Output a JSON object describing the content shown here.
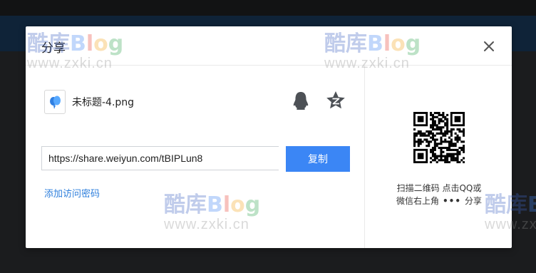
{
  "dialog": {
    "title": "分享",
    "close_icon": "close-icon"
  },
  "file": {
    "name": "未标题-4.png",
    "icon": "image-file-icon"
  },
  "share_targets": [
    {
      "name": "qq-share-button",
      "icon": "qq-penguin-icon"
    },
    {
      "name": "qzone-share-button",
      "icon": "qzone-star-icon"
    }
  ],
  "link": {
    "url": "https://share.weiyun.com/tBIPLun8",
    "copy_label": "复制"
  },
  "add_password_label": "添加访问密码",
  "qr": {
    "caption_line1": "扫描二维码 点击QQ或",
    "caption_line2_pre": "微信右上角",
    "caption_dots": "•••",
    "caption_line2_post": "分享"
  },
  "watermark": {
    "brand_prefix": "酷库",
    "brand_b": "B",
    "brand_l": "l",
    "brand_o": "o",
    "brand_g": "g",
    "url": "www.zxki.cn"
  },
  "colors": {
    "accent": "#3b86f5",
    "link": "#2e7fdc",
    "overlay": "#1b1c1e"
  }
}
